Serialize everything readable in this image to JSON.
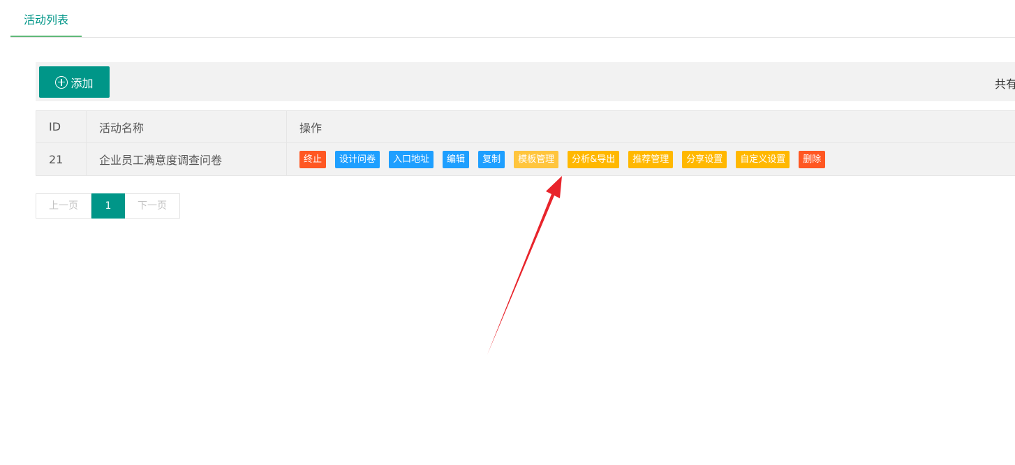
{
  "tabs": [
    {
      "label": "活动列表",
      "active": true
    }
  ],
  "toolbar": {
    "add_label": "添加",
    "total_text": "共有"
  },
  "table": {
    "headers": [
      "ID",
      "活动名称",
      "操作"
    ],
    "rows": [
      {
        "id": "21",
        "name": "企业员工满意度调查问卷"
      }
    ],
    "actions": [
      {
        "label": "终止",
        "color": "#FF5722"
      },
      {
        "label": "设计问卷",
        "color": "#1E9FFF"
      },
      {
        "label": "入口地址",
        "color": "#1E9FFF"
      },
      {
        "label": "编辑",
        "color": "#1E9FFF"
      },
      {
        "label": "复制",
        "color": "#1E9FFF"
      },
      {
        "label": "模板管理",
        "color": "#FFC53D"
      },
      {
        "label": "分析&导出",
        "color": "#FFB800"
      },
      {
        "label": "推荐管理",
        "color": "#FFB800"
      },
      {
        "label": "分享设置",
        "color": "#FFB800"
      },
      {
        "label": "自定义设置",
        "color": "#FFB800"
      },
      {
        "label": "删除",
        "color": "#FF5722"
      }
    ]
  },
  "pagination": {
    "prev": "上一页",
    "current": "1",
    "next": "下一页"
  },
  "colors": {
    "primary": "#009688",
    "tab_underline": "#5FB878",
    "arrow": "#e8242b"
  },
  "annotation": {
    "type": "red-arrow",
    "points_to": "模板管理"
  }
}
